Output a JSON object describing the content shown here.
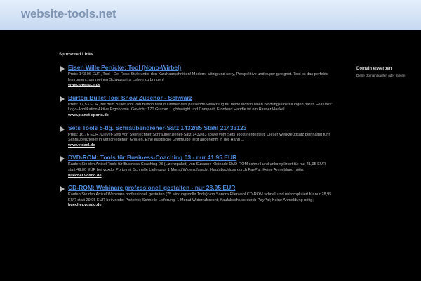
{
  "header": {
    "site_title": "website-tools.net"
  },
  "sponsored_label": "Sponsored Links",
  "ads": [
    {
      "title": "Eisen Wille Perücke: Tool (Nono-Wirbel)",
      "description": "Preis: 143,06 EUR, Tool - Gel Rock-Style unter den Kurzhaarschnitten! Modern, witzig und sexy, Perspektive und super geeignet. Tool ist das perfekte Instrument, um meinen Schwung ins Leben zu bringen!",
      "url": "www.toparuce.de"
    },
    {
      "title": "Burton Bullet Tool Snow Zubehör - Schwarz",
      "description": "Preis: 17,53 EUR, Mit dem Bullet Tool von Burton hast du immer das passende Werkzeug für deine individuellen Bindungseinstellungen parat. Features: Logo-Applikation Aktive Ergonomie. Gewicht: 170 Gramm. Lightweight und Compact: Frontend Handle ist ein Hauser Haakel ...",
      "url": "www.planet-sports.de"
    },
    {
      "title": "Sets Tools 5-tlg. Schraubendreher-Satz 1432/85 Stahl 21433123",
      "description": "Preis: 16,76 EUR, Clever-Sets von Steinlechner Schraubenzieher-Satz 1432/83 sowie vom Sets Tools hergestellt. Dieser Werkzeugsatz beinhaltet fünf Schraubenzieher in verschiedenen Größen. Eine elastische Griffmulde liegt angenehm in der Hand ...",
      "url": "www.vidaxl.de"
    },
    {
      "title": "DVD-ROM: Tools für Business-Coaching 03 - nur 41,95 EUR",
      "description": "Kaufen Sie den Artikel Tools für Business-Coaching 03 (Lizenzpaket) von Susanne Kleinade DVD-ROM schnell und unkompliziert für nur 41,95 EUR statt 49,00 EUR bei voxdo: Portofrei; Schnelle Lieferung; 1 Monat Widerrufsrecht; Kaufabschluss durch PayPal; Keine Anmeldung nötig;",
      "url": "buecher.voxdo.de"
    },
    {
      "title": "CD-ROM: Webinare professionell gestalten - nur 28,95 EUR",
      "description": "Kaufen Sie den Artikel Webinare professionell gestalten (75 wirkungsvolle Tools) von Sandra Ellerwahl CD-ROM schnell und unkompliziert für nur 28,95 EUR statt 29,95 EUR bei voxdo: Portofrei; Schnelle Lieferung; 1 Monat Widerrufsrecht; Kaufabschluss durch PayPal; Keine Anmeldung nötig;",
      "url": "buecher.voxdo.de"
    }
  ],
  "sidebar": {
    "heading": "Domain erwerben",
    "text": "Diese Domain kaufen oder mieten"
  }
}
